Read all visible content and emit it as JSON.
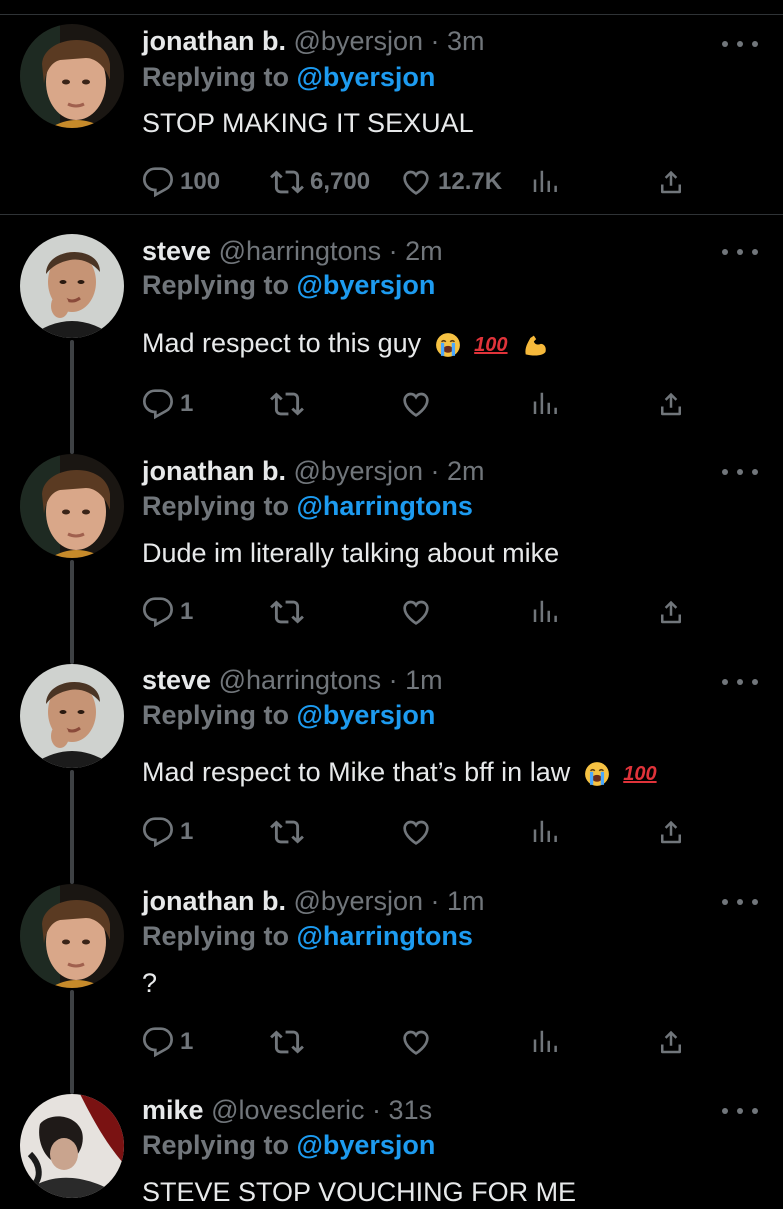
{
  "colors": {
    "background": "#000000",
    "text": "#e7e9ea",
    "muted": "#71767b",
    "link": "#1d9bf0"
  },
  "tweets": [
    {
      "name": "jonathan b.",
      "handle": "@byersjon",
      "time": "3m",
      "replying_prefix": "Replying to",
      "replying_to": "@byersjon",
      "text": "STOP MAKING IT SEXUAL",
      "replies": "100",
      "retweets": "6,700",
      "likes": "12.7K"
    },
    {
      "name": "steve",
      "handle": "@harringtons",
      "time": "2m",
      "replying_prefix": "Replying to",
      "replying_to": "@byersjon",
      "text": "Mad respect to this guy",
      "emojis": [
        "loudly-crying-face",
        "hundred-points",
        "flexed-biceps"
      ],
      "replies": "1",
      "retweets": "",
      "likes": ""
    },
    {
      "name": "jonathan b.",
      "handle": "@byersjon",
      "time": "2m",
      "replying_prefix": "Replying to",
      "replying_to": "@harringtons",
      "text": "Dude im literally talking about mike",
      "replies": "1",
      "retweets": "",
      "likes": ""
    },
    {
      "name": "steve",
      "handle": "@harringtons",
      "time": "1m",
      "replying_prefix": "Replying to",
      "replying_to": "@byersjon",
      "text": "Mad respect to Mike that’s bff in law",
      "emojis": [
        "loudly-crying-face",
        "hundred-points"
      ],
      "replies": "1",
      "retweets": "",
      "likes": ""
    },
    {
      "name": "jonathan b.",
      "handle": "@byersjon",
      "time": "1m",
      "replying_prefix": "Replying to",
      "replying_to": "@harringtons",
      "text": "?",
      "replies": "1",
      "retweets": "",
      "likes": ""
    },
    {
      "name": "mike",
      "handle": "@lovescleric",
      "time": "31s",
      "replying_prefix": "Replying to",
      "replying_to": "@byersjon",
      "text": "STEVE STOP VOUCHING FOR ME"
    }
  ],
  "hundred_glyph": "100"
}
